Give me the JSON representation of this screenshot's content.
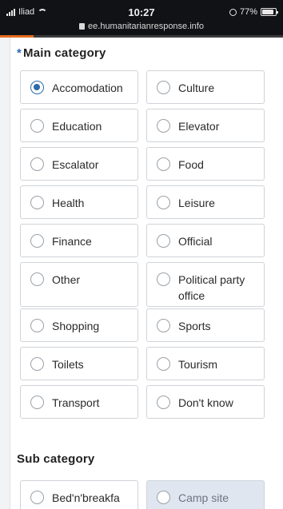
{
  "status_bar": {
    "carrier": "Iliad",
    "time": "10:27",
    "battery": "77%",
    "url": "ee.humanitarianresponse.info",
    "page_load_progress": 0.12
  },
  "icons": [
    "signal-icon",
    "wifi-icon",
    "alarm-icon",
    "battery-icon",
    "lock-icon",
    "radio-icon"
  ],
  "colors": {
    "accent": "#2d6aa8",
    "required_star": "#2c6bb3",
    "load_bar": "#e56b1f",
    "shaded_option": "#dfe6ef"
  },
  "main_category": {
    "required_mark": "*",
    "title": "Main category",
    "selected": "Accomodation",
    "options": [
      "Accomodation",
      "Culture",
      "Education",
      "Elevator",
      "Escalator",
      "Food",
      "Health",
      "Leisure",
      "Finance",
      "Official",
      "Other",
      "Political party office",
      "Shopping",
      "Sports",
      "Toilets",
      "Tourism",
      "Transport",
      "Don't know"
    ]
  },
  "sub_category": {
    "title": "Sub category",
    "options": [
      "Bed'n'breakfa",
      "Camp site"
    ]
  }
}
